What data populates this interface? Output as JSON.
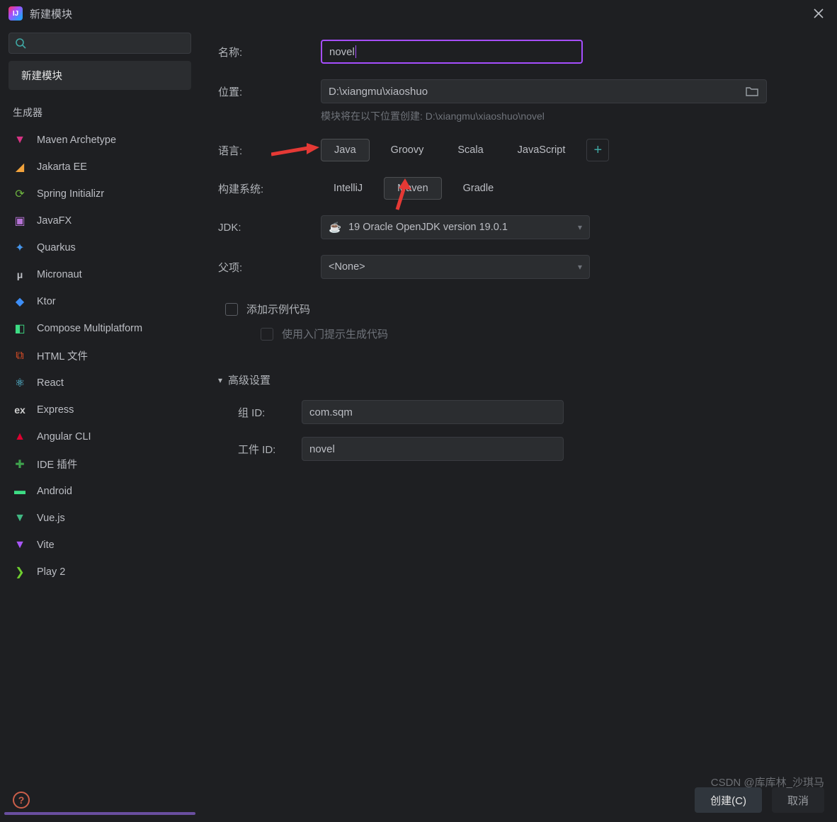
{
  "title": "新建模块",
  "sidebar": {
    "selected": "新建模块",
    "group": "生成器",
    "items": [
      {
        "label": "Maven Archetype",
        "iconColor": "#d63384",
        "glyph": "▼"
      },
      {
        "label": "Jakarta EE",
        "iconColor": "#f2a33c",
        "glyph": "◢"
      },
      {
        "label": "Spring Initializr",
        "iconColor": "#6db33f",
        "glyph": "⟳"
      },
      {
        "label": "JavaFX",
        "iconColor": "#b673d6",
        "glyph": "▣"
      },
      {
        "label": "Quarkus",
        "iconColor": "#4695eb",
        "glyph": "✦"
      },
      {
        "label": "Micronaut",
        "iconColor": "#bcbec4",
        "glyph": "μ"
      },
      {
        "label": "Ktor",
        "iconColor": "#3d8ef7",
        "glyph": "◆"
      },
      {
        "label": "Compose Multiplatform",
        "iconColor": "#3ddc84",
        "glyph": "◧"
      },
      {
        "label": "HTML 文件",
        "iconColor": "#e34f26",
        "glyph": "⧉"
      },
      {
        "label": "React",
        "iconColor": "#61dafb",
        "glyph": "⚛"
      },
      {
        "label": "Express",
        "iconColor": "#cfcfcf",
        "glyph": "ex"
      },
      {
        "label": "Angular CLI",
        "iconColor": "#dd0031",
        "glyph": "▲"
      },
      {
        "label": "IDE 插件",
        "iconColor": "#3fa14d",
        "glyph": "✚"
      },
      {
        "label": "Android",
        "iconColor": "#3ddc84",
        "glyph": "▬"
      },
      {
        "label": "Vue.js",
        "iconColor": "#41b883",
        "glyph": "▼"
      },
      {
        "label": "Vite",
        "iconColor": "#a856f7",
        "glyph": "▼"
      },
      {
        "label": "Play 2",
        "iconColor": "#6fcf2f",
        "glyph": "❯"
      }
    ]
  },
  "fields": {
    "name_label": "名称:",
    "name_value": "novel",
    "location_label": "位置:",
    "location_value": "D:\\xiangmu\\xiaoshuo",
    "location_hint": "模块将在以下位置创建: D:\\xiangmu\\xiaoshuo\\novel",
    "language_label": "语言:",
    "language_options": [
      "Java",
      "Groovy",
      "Scala",
      "JavaScript"
    ],
    "language_selected": "Java",
    "build_label": "构建系统:",
    "build_options": [
      "IntelliJ",
      "Maven",
      "Gradle"
    ],
    "build_selected": "Maven",
    "jdk_label": "JDK:",
    "jdk_value": "19 Oracle OpenJDK version 19.0.1",
    "parent_label": "父项:",
    "parent_value": "<None>",
    "add_sample_label": "添加示例代码",
    "use_hint_label": "使用入门提示生成代码",
    "advanced_label": "高级设置",
    "group_id_label": "组 ID:",
    "group_id_value": "com.sqm",
    "artifact_id_label": "工件 ID:",
    "artifact_id_value": "novel"
  },
  "footer": {
    "create": "创建(C)",
    "cancel": "取消"
  },
  "watermark": "CSDN @库库林_沙琪马"
}
